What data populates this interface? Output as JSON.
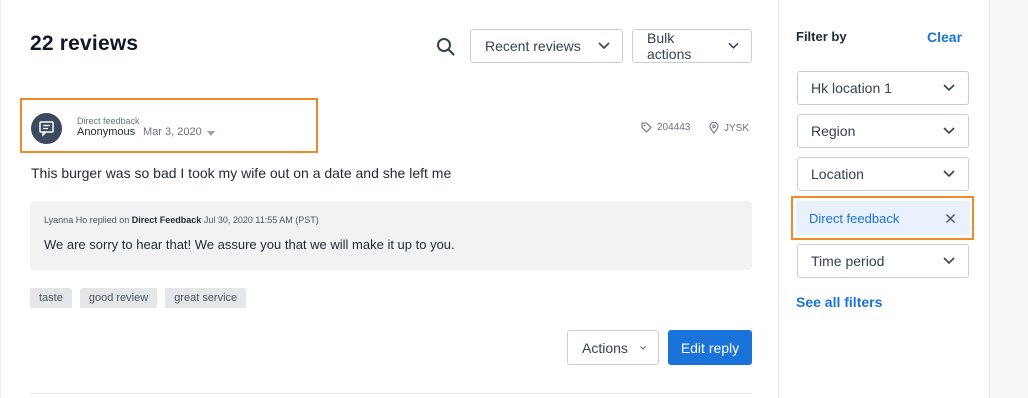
{
  "header": {
    "title": "22 reviews",
    "sort_dropdown": "Recent reviews",
    "bulk_dropdown": "Bulk actions"
  },
  "review": {
    "source": "Direct feedback",
    "author": "Anonymous",
    "date": "Mar 3, 2020",
    "store_id": "204443",
    "location": "JYSK",
    "text": "This burger was so bad I took my wife out on a date and she left me",
    "reply": {
      "author": "Lyanna Ho",
      "replied_on": "replied on",
      "target": "Direct Feedback",
      "timestamp": "Jul 30, 2020 11:55 AM (PST)",
      "text": "We are sorry to hear that! We assure you that we will make it up to you."
    },
    "tags": [
      "taste",
      "good review",
      "great service"
    ],
    "actions_label": "Actions",
    "edit_reply_label": "Edit reply"
  },
  "sidebar": {
    "title": "Filter by",
    "clear_label": "Clear",
    "filters": [
      "Hk location 1",
      "Region",
      "Location"
    ],
    "active_filter": "Direct feedback",
    "time_period": "Time period",
    "see_all_label": "See all filters"
  },
  "colors": {
    "accent": "#1a73d9",
    "highlight": "#f08a24",
    "avatar": "#3b4a5e",
    "active_filter_bg": "#e8f1fc"
  }
}
